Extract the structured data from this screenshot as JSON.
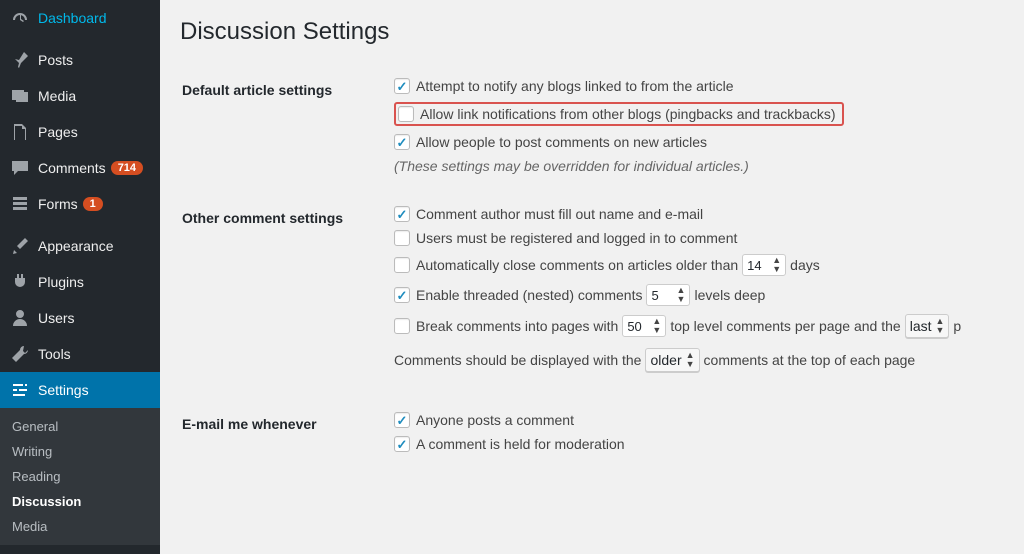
{
  "sidebar": {
    "dashboard": "Dashboard",
    "posts": "Posts",
    "media": "Media",
    "pages": "Pages",
    "comments": "Comments",
    "comments_count": "714",
    "forms": "Forms",
    "forms_count": "1",
    "appearance": "Appearance",
    "plugins": "Plugins",
    "users": "Users",
    "tools": "Tools",
    "settings": "Settings",
    "sub": {
      "general": "General",
      "writing": "Writing",
      "reading": "Reading",
      "discussion": "Discussion",
      "media": "Media"
    }
  },
  "page": {
    "title": "Discussion Settings",
    "sections": {
      "default_article": {
        "heading": "Default article settings",
        "notify_blogs": {
          "checked": true,
          "label": "Attempt to notify any blogs linked to from the article"
        },
        "allow_pingbacks": {
          "checked": false,
          "label": "Allow link notifications from other blogs (pingbacks and trackbacks)"
        },
        "allow_comments": {
          "checked": true,
          "label": "Allow people to post comments on new articles"
        },
        "note": "(These settings may be overridden for individual articles.)"
      },
      "other_comment": {
        "heading": "Other comment settings",
        "require_name_email": {
          "checked": true,
          "label": "Comment author must fill out name and e-mail"
        },
        "require_registered": {
          "checked": false,
          "label": "Users must be registered and logged in to comment"
        },
        "auto_close": {
          "checked": false,
          "label_before": "Automatically close comments on articles older than",
          "days_value": "14",
          "label_after": "days"
        },
        "threaded": {
          "checked": true,
          "label_before": "Enable threaded (nested) comments",
          "levels_value": "5",
          "label_after": "levels deep"
        },
        "paginate": {
          "checked": false,
          "label_before": "Break comments into pages with",
          "per_page_value": "50",
          "label_mid": "top level comments per page and the",
          "page_select": "last",
          "label_after": "p"
        },
        "display_order": {
          "label_before": "Comments should be displayed with the",
          "order_select": "older",
          "label_after": "comments at the top of each page"
        }
      },
      "email_me": {
        "heading": "E-mail me whenever",
        "anyone_posts": {
          "checked": true,
          "label": "Anyone posts a comment"
        },
        "held_moderation": {
          "checked": true,
          "label": "A comment is held for moderation"
        }
      }
    }
  }
}
